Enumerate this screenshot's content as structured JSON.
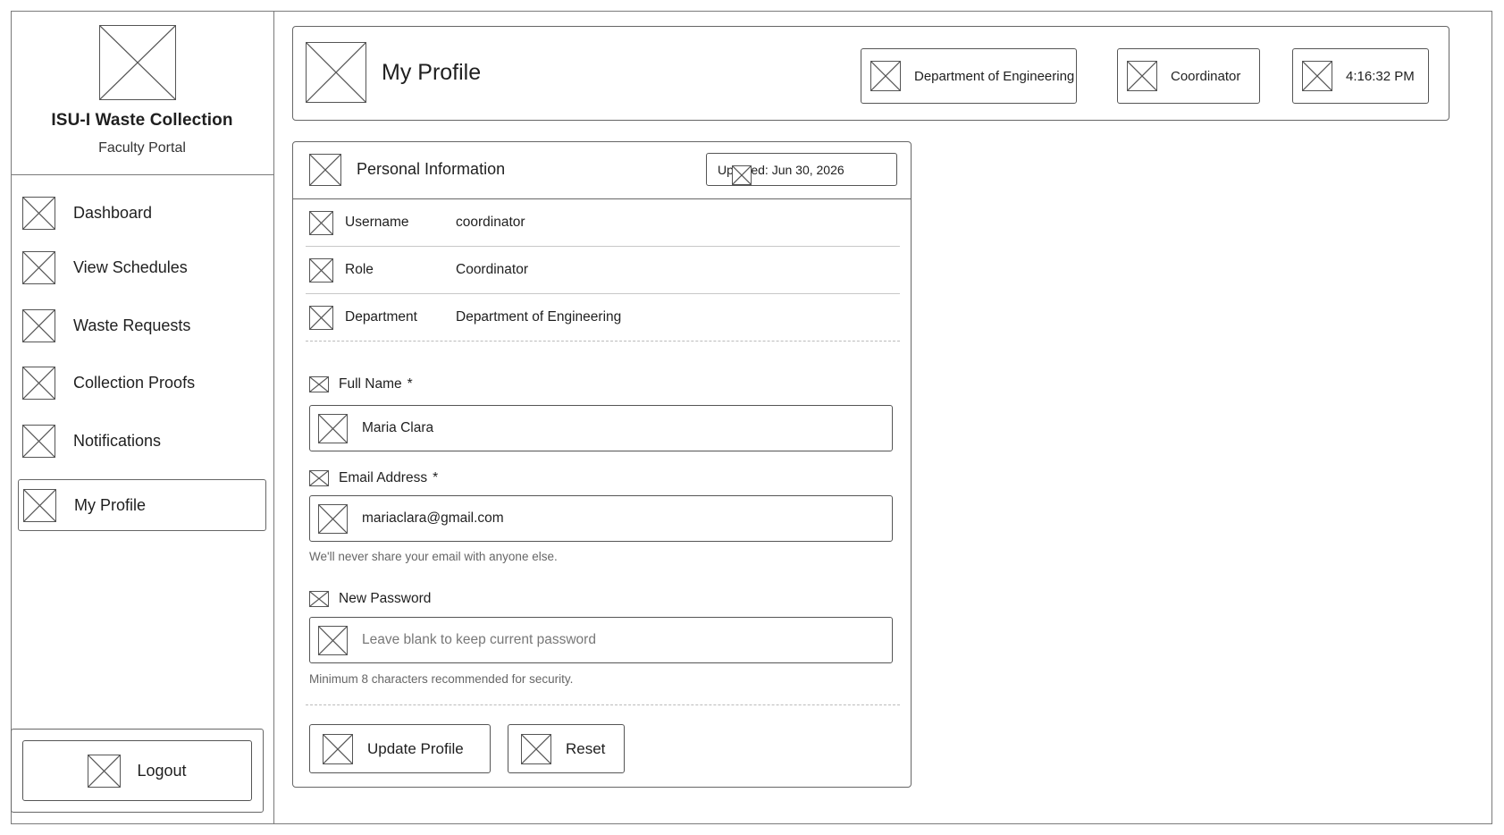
{
  "sidebar": {
    "app_title": "ISU-I Waste Collection",
    "app_subtitle": "Faculty Portal",
    "items": [
      {
        "label": "Dashboard"
      },
      {
        "label": "View Schedules"
      },
      {
        "label": "Waste Requests"
      },
      {
        "label": "Collection Proofs"
      },
      {
        "label": "Notifications"
      },
      {
        "label": "My Profile"
      }
    ],
    "active_item": "My Profile",
    "logout_label": "Logout"
  },
  "header": {
    "title": "My Profile",
    "department": "Department of Engineering",
    "role": "Coordinator",
    "time": "4:16:32 PM"
  },
  "card": {
    "title": "Personal Information",
    "updated": "Updated: Jun 30, 2026",
    "info": {
      "username_label": "Username",
      "username_value": "coordinator",
      "role_label": "Role",
      "role_value": "Coordinator",
      "department_label": "Department",
      "department_value": "Department of Engineering"
    },
    "form": {
      "full_name_label": "Full Name",
      "full_name_value": "Maria Clara",
      "email_label": "Email Address",
      "email_value": "mariaclara@gmail.com",
      "email_hint": "We'll never share your email with anyone else.",
      "password_label": "New Password",
      "password_value": "",
      "password_placeholder": "Leave blank to keep current password",
      "password_hint": "Minimum 8 characters recommended for security.",
      "required_marker": "*"
    },
    "buttons": {
      "update_label": "Update Profile",
      "reset_label": "Reset"
    }
  }
}
